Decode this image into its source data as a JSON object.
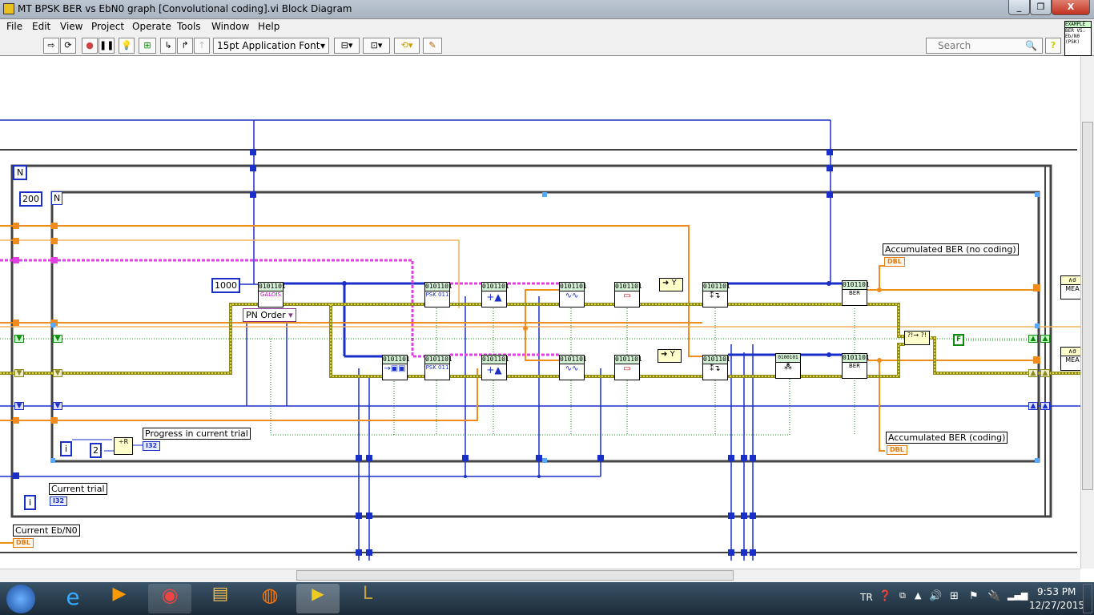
{
  "window": {
    "title": "MT BPSK BER vs EbN0 graph [Convolutional coding].vi Block Diagram",
    "min": "_",
    "max": "❐",
    "close": "X"
  },
  "menu": [
    "File",
    "Edit",
    "View",
    "Project",
    "Operate",
    "Tools",
    "Window",
    "Help"
  ],
  "toolbar": {
    "font": "15pt Application Font",
    "search_placeholder": "Search",
    "help": "?"
  },
  "vi_icon": {
    "top": "EXAMPLE",
    "body": "BER VS. Eb/N0 (PSK)"
  },
  "diagram": {
    "loop_count_outer": "N",
    "loop_count_inner": "N",
    "iter_inner": "i",
    "iter_outer": "i",
    "const_200": "200",
    "const_1000": "1000",
    "const_2": "2",
    "pn_order": "PN Order",
    "select_y": "Y",
    "bool_false": "F",
    "node_header": "0101101",
    "node_header_wide": "0100101 0",
    "galois": "GALOIS",
    "psk": "PSK 011",
    "ber": "BER",
    "mean": "MEA",
    "progress_label": "Progress in current trial",
    "current_trial_label": "Current trial",
    "current_ebn0_label": "Current Eb/N0",
    "ber_nocoding_label": "Accumulated BER (no coding)",
    "ber_coding_label": "Accumulated BER (coding)",
    "i32": "I32",
    "dbl": "DBL"
  },
  "wire_colors": {
    "int": "#1a2fc8",
    "dbl": "#f08c1e",
    "string": "#e040e0",
    "bool": "#0a8a0a",
    "cluster": "#8a8a20"
  },
  "taskbar": {
    "lang": "TR",
    "time": "9:53 PM",
    "date": "12/27/2015"
  }
}
